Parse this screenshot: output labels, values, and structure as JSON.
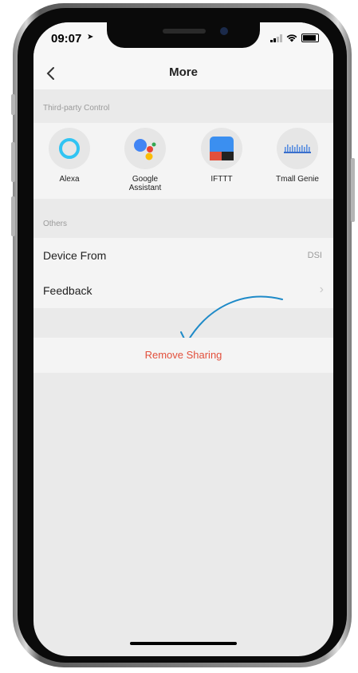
{
  "status_bar": {
    "time": "09:07"
  },
  "nav": {
    "title": "More",
    "back_icon": "chevron-left-icon"
  },
  "third_party": {
    "header": "Third-party Control",
    "items": [
      {
        "label": "Alexa",
        "icon": "alexa-icon"
      },
      {
        "label": "Google Assistant",
        "icon": "google-assistant-icon"
      },
      {
        "label": "IFTTT",
        "icon": "ifttt-icon"
      },
      {
        "label": "Tmall Genie",
        "icon": "tmall-genie-icon"
      }
    ]
  },
  "others": {
    "header": "Others",
    "device_from": {
      "label": "Device From",
      "value": "DSI"
    },
    "feedback": {
      "label": "Feedback"
    }
  },
  "remove_sharing": {
    "label": "Remove Sharing"
  },
  "colors": {
    "accent_red": "#e2503c",
    "arrow_blue": "#1e8ac8",
    "alexa_blue": "#31c4f3",
    "google_blue": "#4285f4",
    "ifttt_blue": "#3b8ff0"
  }
}
